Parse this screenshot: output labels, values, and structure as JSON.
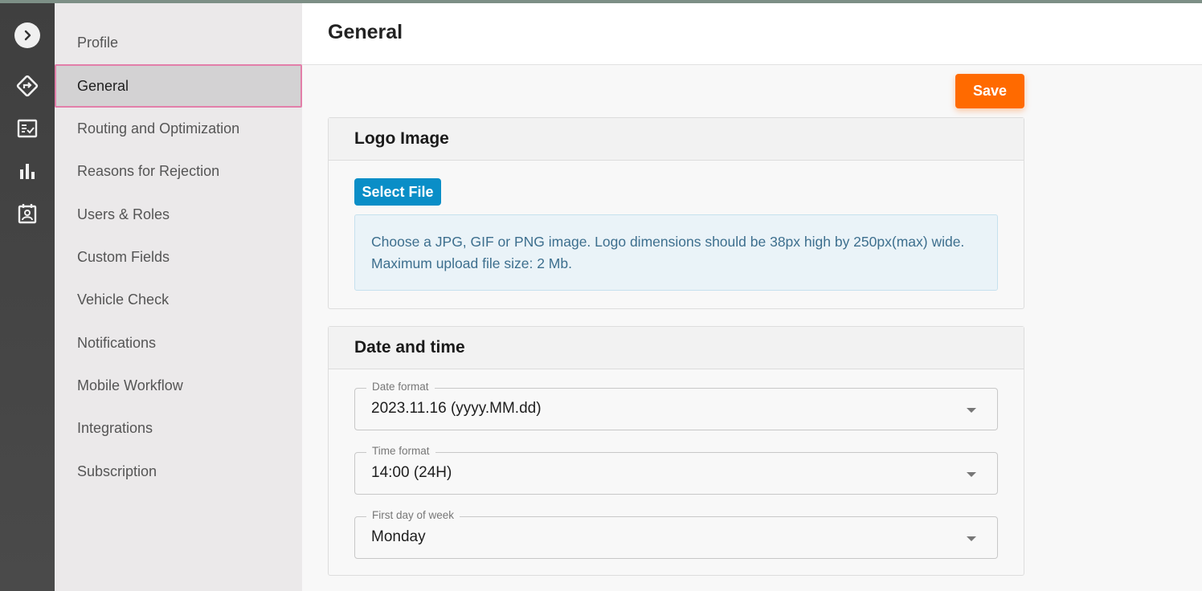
{
  "nav": {
    "items": [
      {
        "label": "Profile",
        "active": false
      },
      {
        "label": "General",
        "active": true
      },
      {
        "label": "Routing and Optimization",
        "active": false
      },
      {
        "label": "Reasons for Rejection",
        "active": false
      },
      {
        "label": "Users & Roles",
        "active": false
      },
      {
        "label": "Custom Fields",
        "active": false
      },
      {
        "label": "Vehicle Check",
        "active": false
      },
      {
        "label": "Notifications",
        "active": false
      },
      {
        "label": "Mobile Workflow",
        "active": false
      },
      {
        "label": "Integrations",
        "active": false
      },
      {
        "label": "Subscription",
        "active": false
      }
    ]
  },
  "rail": {
    "icons": [
      "chevron-right-icon",
      "route-sign-icon",
      "checklist-icon",
      "bar-chart-icon",
      "contact-card-icon"
    ]
  },
  "header": {
    "title": "General"
  },
  "toolbar": {
    "save_label": "Save"
  },
  "logo_card": {
    "title": "Logo Image",
    "select_label": "Select File",
    "info": "Choose a JPG, GIF or PNG image. Logo dimensions should be 38px high by 250px(max) wide. Maximum upload file size: 2 Mb."
  },
  "datetime_card": {
    "title": "Date and time",
    "date_format": {
      "label": "Date format",
      "value": "2023.11.16 (yyyy.MM.dd)"
    },
    "time_format": {
      "label": "Time format",
      "value": "14:00 (24H)"
    },
    "first_day": {
      "label": "First day of week",
      "value": "Monday"
    }
  },
  "colors": {
    "accent": "#ff6a00",
    "primary": "#0a8ec7",
    "active_border": "#e27fa9",
    "rail": "#444444"
  }
}
